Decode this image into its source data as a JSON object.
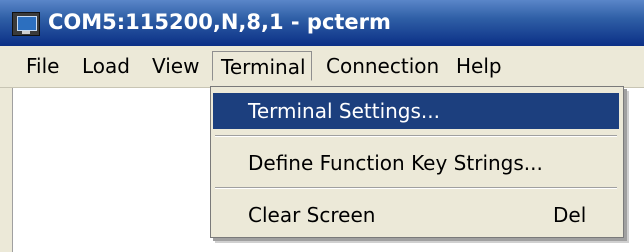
{
  "window": {
    "title": "COM5:115200,N,8,1 - pcterm",
    "icon": "terminal-icon"
  },
  "menubar": {
    "items": [
      "File",
      "Load",
      "View",
      "Terminal",
      "Connection",
      "Help"
    ],
    "open_menu": "Terminal"
  },
  "terminal_menu": {
    "items": [
      {
        "label": "Terminal Settings...",
        "shortcut": "",
        "selected": true
      },
      {
        "label": "Define Function Key Strings...",
        "shortcut": "",
        "selected": false
      },
      {
        "label": "Clear Screen",
        "shortcut": "Del",
        "selected": false
      }
    ]
  },
  "colors": {
    "title_bar": "#0b2f86",
    "menu_background": "#ece9d8",
    "selection": "#1c3f7e"
  }
}
